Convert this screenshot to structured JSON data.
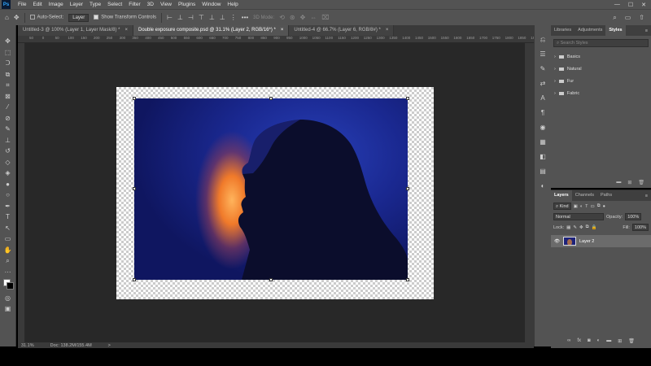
{
  "menubar": {
    "logo": "Ps",
    "items": [
      "File",
      "Edit",
      "Image",
      "Layer",
      "Type",
      "Select",
      "Filter",
      "3D",
      "View",
      "Plugins",
      "Window",
      "Help"
    ],
    "window_controls": [
      "—",
      "☐",
      "✕"
    ]
  },
  "options": {
    "auto_select_label": "Auto-Select:",
    "auto_select_target": "Layer",
    "show_transform_label": "Show Transform Controls",
    "more_label": "•••",
    "mode_3d_label": "3D Mode:"
  },
  "tabs": [
    {
      "label": "Untitled-3 @ 100% (Layer 1, Layer Mask/8) *",
      "close": "×"
    },
    {
      "label": "Double exposure composite.psd @ 31.1% (Layer 2, RGB/16*) *",
      "close": "×"
    },
    {
      "label": "Untitled-4 @ 66.7% (Layer 6, RGB/8#) *",
      "close": "×"
    }
  ],
  "ruler_labels": [
    "50",
    "0",
    "50",
    "100",
    "150",
    "200",
    "250",
    "300",
    "350",
    "400",
    "450",
    "500",
    "550",
    "600",
    "650",
    "700",
    "750",
    "800",
    "850",
    "900",
    "950",
    "1000",
    "1050",
    "1100",
    "1150",
    "1200",
    "1250",
    "1300",
    "1350",
    "1400",
    "1450",
    "1500",
    "1550",
    "1600",
    "1650",
    "1700",
    "1750",
    "1800",
    "1850",
    "1900"
  ],
  "status": {
    "zoom": "31.1%",
    "doc": "Doc: 138.2M/155.4M",
    "arrow": ">"
  },
  "styles_panel": {
    "tabs": [
      "Libraries",
      "Adjustments",
      "Styles"
    ],
    "active_tab": "Styles",
    "search_placeholder": "Search Styles",
    "folders": [
      "Basics",
      "Natural",
      "Fur",
      "Fabric"
    ]
  },
  "layers_panel": {
    "tabs": [
      "Layers",
      "Channels",
      "Paths"
    ],
    "active_tab": "Layers",
    "kind_label": "Kind",
    "blend_mode": "Normal",
    "opacity_label": "Opacity:",
    "opacity_value": "100%",
    "lock_label": "Lock:",
    "fill_label": "Fill:",
    "fill_value": "100%",
    "layers": [
      {
        "name": "Layer 2",
        "visible": true
      }
    ]
  },
  "colors": {
    "ui_dark": "#535353",
    "canvas_bg": "#282828",
    "accent": "#31a8ff"
  }
}
